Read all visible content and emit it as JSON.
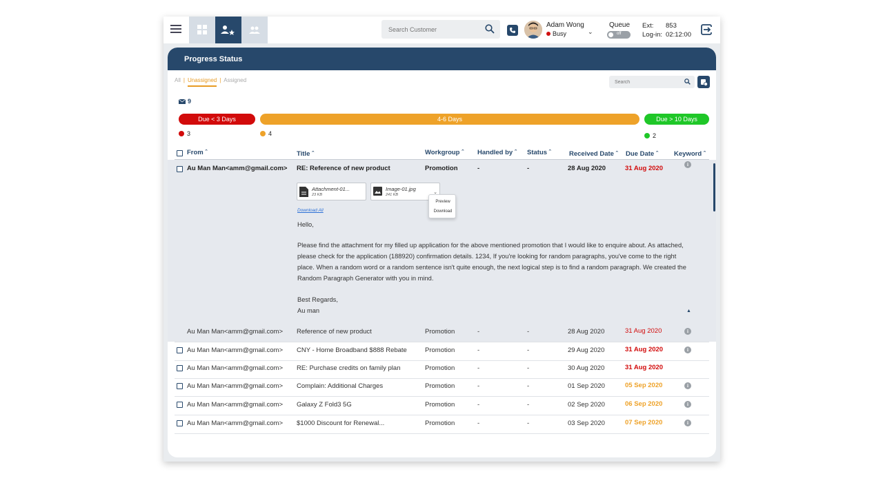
{
  "topbar": {
    "search_placeholder": "Search Customer",
    "user_name": "Adam Wong",
    "user_status": "Busy",
    "queue_label": "Queue",
    "queue_toggle": "off",
    "ext_label": "Ext:",
    "ext_value": "853",
    "login_label": "Log-in:",
    "login_value": "02:12:00"
  },
  "panel": {
    "title": "Progress Status",
    "tabs": [
      "All",
      "Unassigned",
      "Assigned"
    ],
    "active_tab": "Unassigned",
    "search_placeholder": "Search",
    "mail_count": "9"
  },
  "due": {
    "red_label": "Due < 3 Days",
    "orange_label": "4-6 Days",
    "green_label": "Due > 10 Days",
    "red_count": "3",
    "orange_count": "4",
    "green_count": "2"
  },
  "columns": {
    "from": "From",
    "title": "Title",
    "workgroup": "Workgroup",
    "handled_by": "Handled by",
    "status": "Status",
    "received": "Received Date",
    "due": "Due Date",
    "keyword": "Keyword"
  },
  "expanded": {
    "from": "Au Man Man<amm@gmail.com>",
    "title": "RE: Reference of new product",
    "workgroup": "Promotion",
    "handled_by": "-",
    "status": "-",
    "received": "28 Aug 2020",
    "due": "31 Aug 2020",
    "attachments": [
      {
        "name": "Attachment-01...",
        "size": "23 KB"
      },
      {
        "name": "Image-01.jpg",
        "size": "241 KB"
      }
    ],
    "menu_preview": "Preview",
    "menu_download": "Download",
    "download_all": "Download All",
    "greeting": "Hello,",
    "body_lines": [
      "Please find the attachment for my filled up application for the above mentioned promotion that I would like to enquire about. As attached,",
      "please check for the application (188920) confirmation details. 1234, If you're looking for random paragraphs, you've come to the right",
      "place. When a random word or a random sentence isn't quite enough, the next logical step is to find a random paragraph. We created the",
      "Random Paragraph Generator with you in mind."
    ],
    "regards": "Best Regards,",
    "signature": "Au man"
  },
  "rows": [
    {
      "from": "Au Man Man<amm@gmail.com>",
      "title": "Reference of new product",
      "workgroup": "Promotion",
      "handled_by": "-",
      "status": "-",
      "received": "28 Aug 2020",
      "due": "31 Aug 2020",
      "due_color": "red-normal",
      "info": true,
      "checkbox": false
    },
    {
      "from": "Au Man Man<amm@gmail.com>",
      "title": "CNY - Home Broadband $888 Rebate",
      "workgroup": "Promotion",
      "handled_by": "-",
      "status": "-",
      "received": "29 Aug 2020",
      "due": "31 Aug 2020",
      "due_color": "red",
      "info": true,
      "checkbox": true
    },
    {
      "from": "Au Man Man<amm@gmail.com>",
      "title": "RE: Purchase credits on family plan",
      "workgroup": "Promotion",
      "handled_by": "-",
      "status": "-",
      "received": "30 Aug 2020",
      "due": "31 Aug 2020",
      "due_color": "red",
      "info": false,
      "checkbox": true
    },
    {
      "from": "Au Man Man<amm@gmail.com>",
      "title": "Complain: Additional Charges",
      "workgroup": "Promotion",
      "handled_by": "-",
      "status": "-",
      "received": "01 Sep 2020",
      "due": "05 Sep 2020",
      "due_color": "orange",
      "info": true,
      "checkbox": true
    },
    {
      "from": "Au Man Man<amm@gmail.com>",
      "title": "Galaxy Z Fold3 5G",
      "workgroup": "Promotion",
      "handled_by": "-",
      "status": "-",
      "received": "02 Sep 2020",
      "due": "06 Sep 2020",
      "due_color": "orange",
      "info": true,
      "checkbox": true
    },
    {
      "from": "Au Man Man<amm@gmail.com>",
      "title": "$1000 Discount for Renewal...",
      "workgroup": "Promotion",
      "handled_by": "-",
      "status": "-",
      "received": "03 Sep 2020",
      "due": "07 Sep 2020",
      "due_color": "orange",
      "info": true,
      "checkbox": true
    }
  ],
  "colors": {
    "navy": "#27486b",
    "red": "#d20b0b",
    "orange": "#eea229",
    "green": "#1fc728"
  },
  "icons": [
    "menu-icon",
    "dashboard-icon",
    "agent-star-icon",
    "group-icon",
    "search-icon",
    "phone-icon",
    "logout-icon",
    "mail-icon",
    "settings-icon",
    "document-icon",
    "image-icon",
    "info-icon",
    "chevron-down-icon",
    "caret-up-icon"
  ]
}
